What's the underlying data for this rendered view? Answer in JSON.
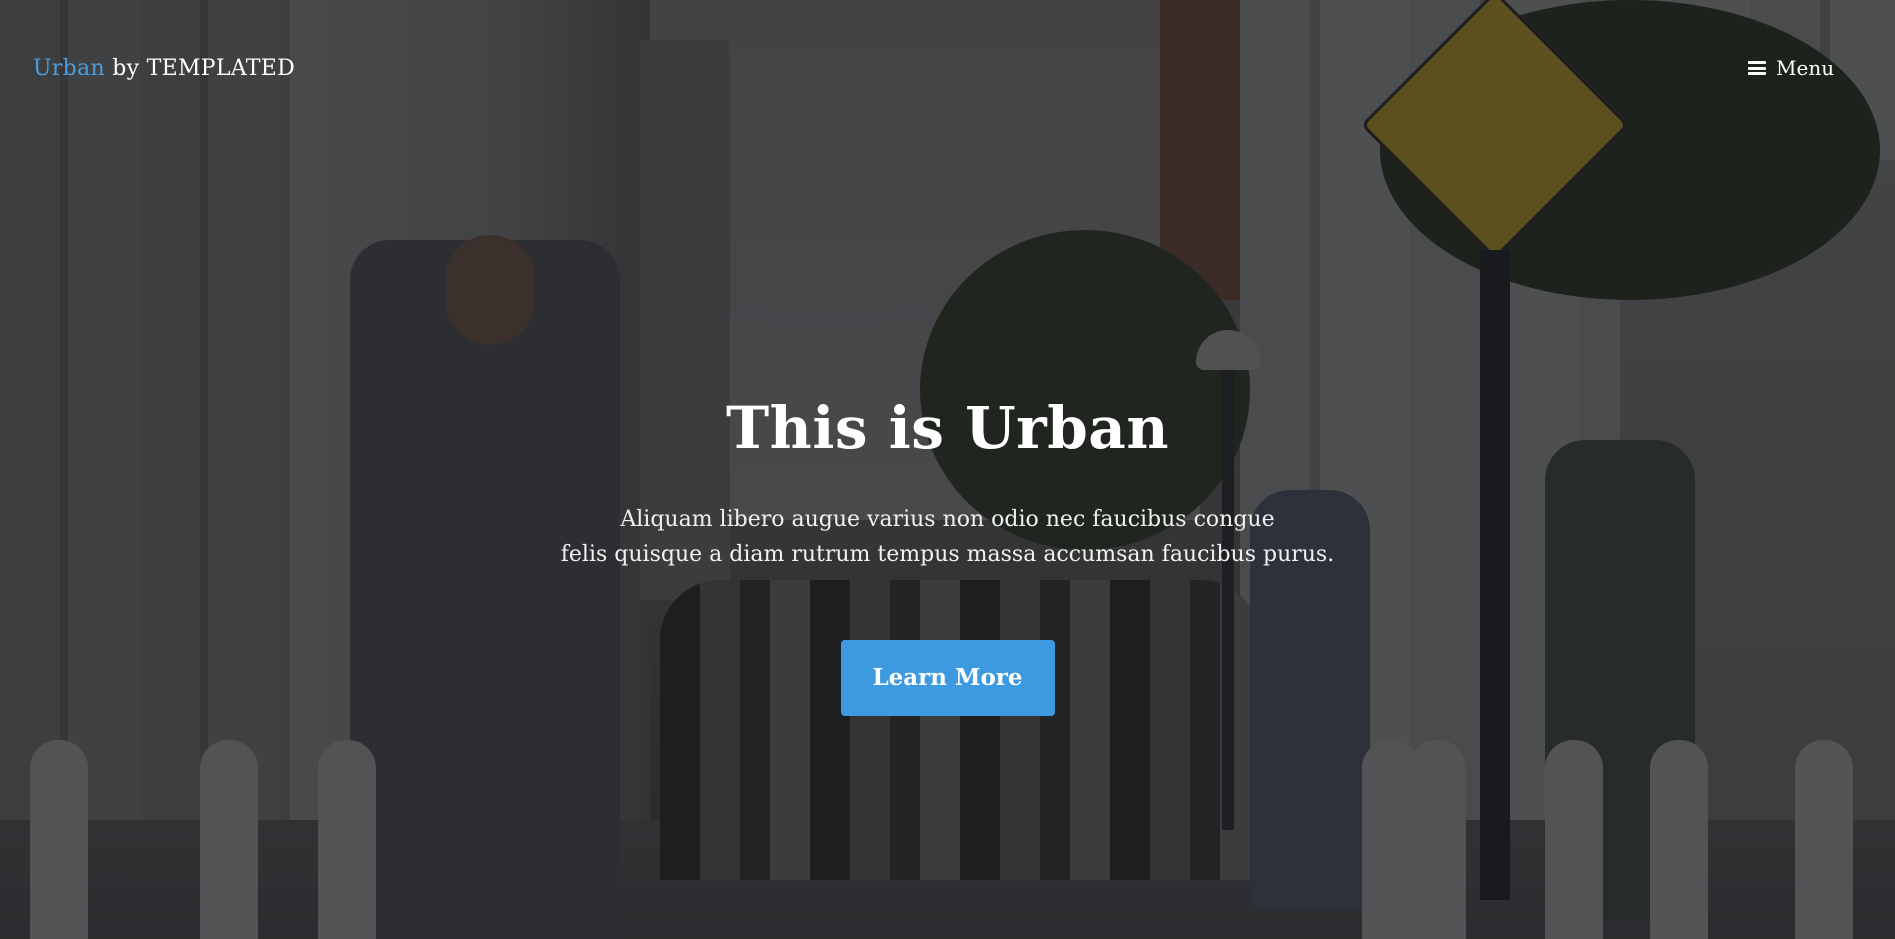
{
  "header": {
    "logo_brand": "Urban",
    "logo_rest": " by TEMPLATED",
    "menu_label": "Menu",
    "menu_icon": "hamburger-icon"
  },
  "hero": {
    "title": "This is Urban",
    "text_line1": "Aliquam libero augue varius non odio nec faucibus congue",
    "text_line2": "felis quisque a diam rutrum tempus massa accumsan faucibus purus.",
    "button_label": "Learn More"
  },
  "colors": {
    "accent": "#3d9ae0",
    "brand_text": "#4a9fe0",
    "overlay": "#141416"
  }
}
